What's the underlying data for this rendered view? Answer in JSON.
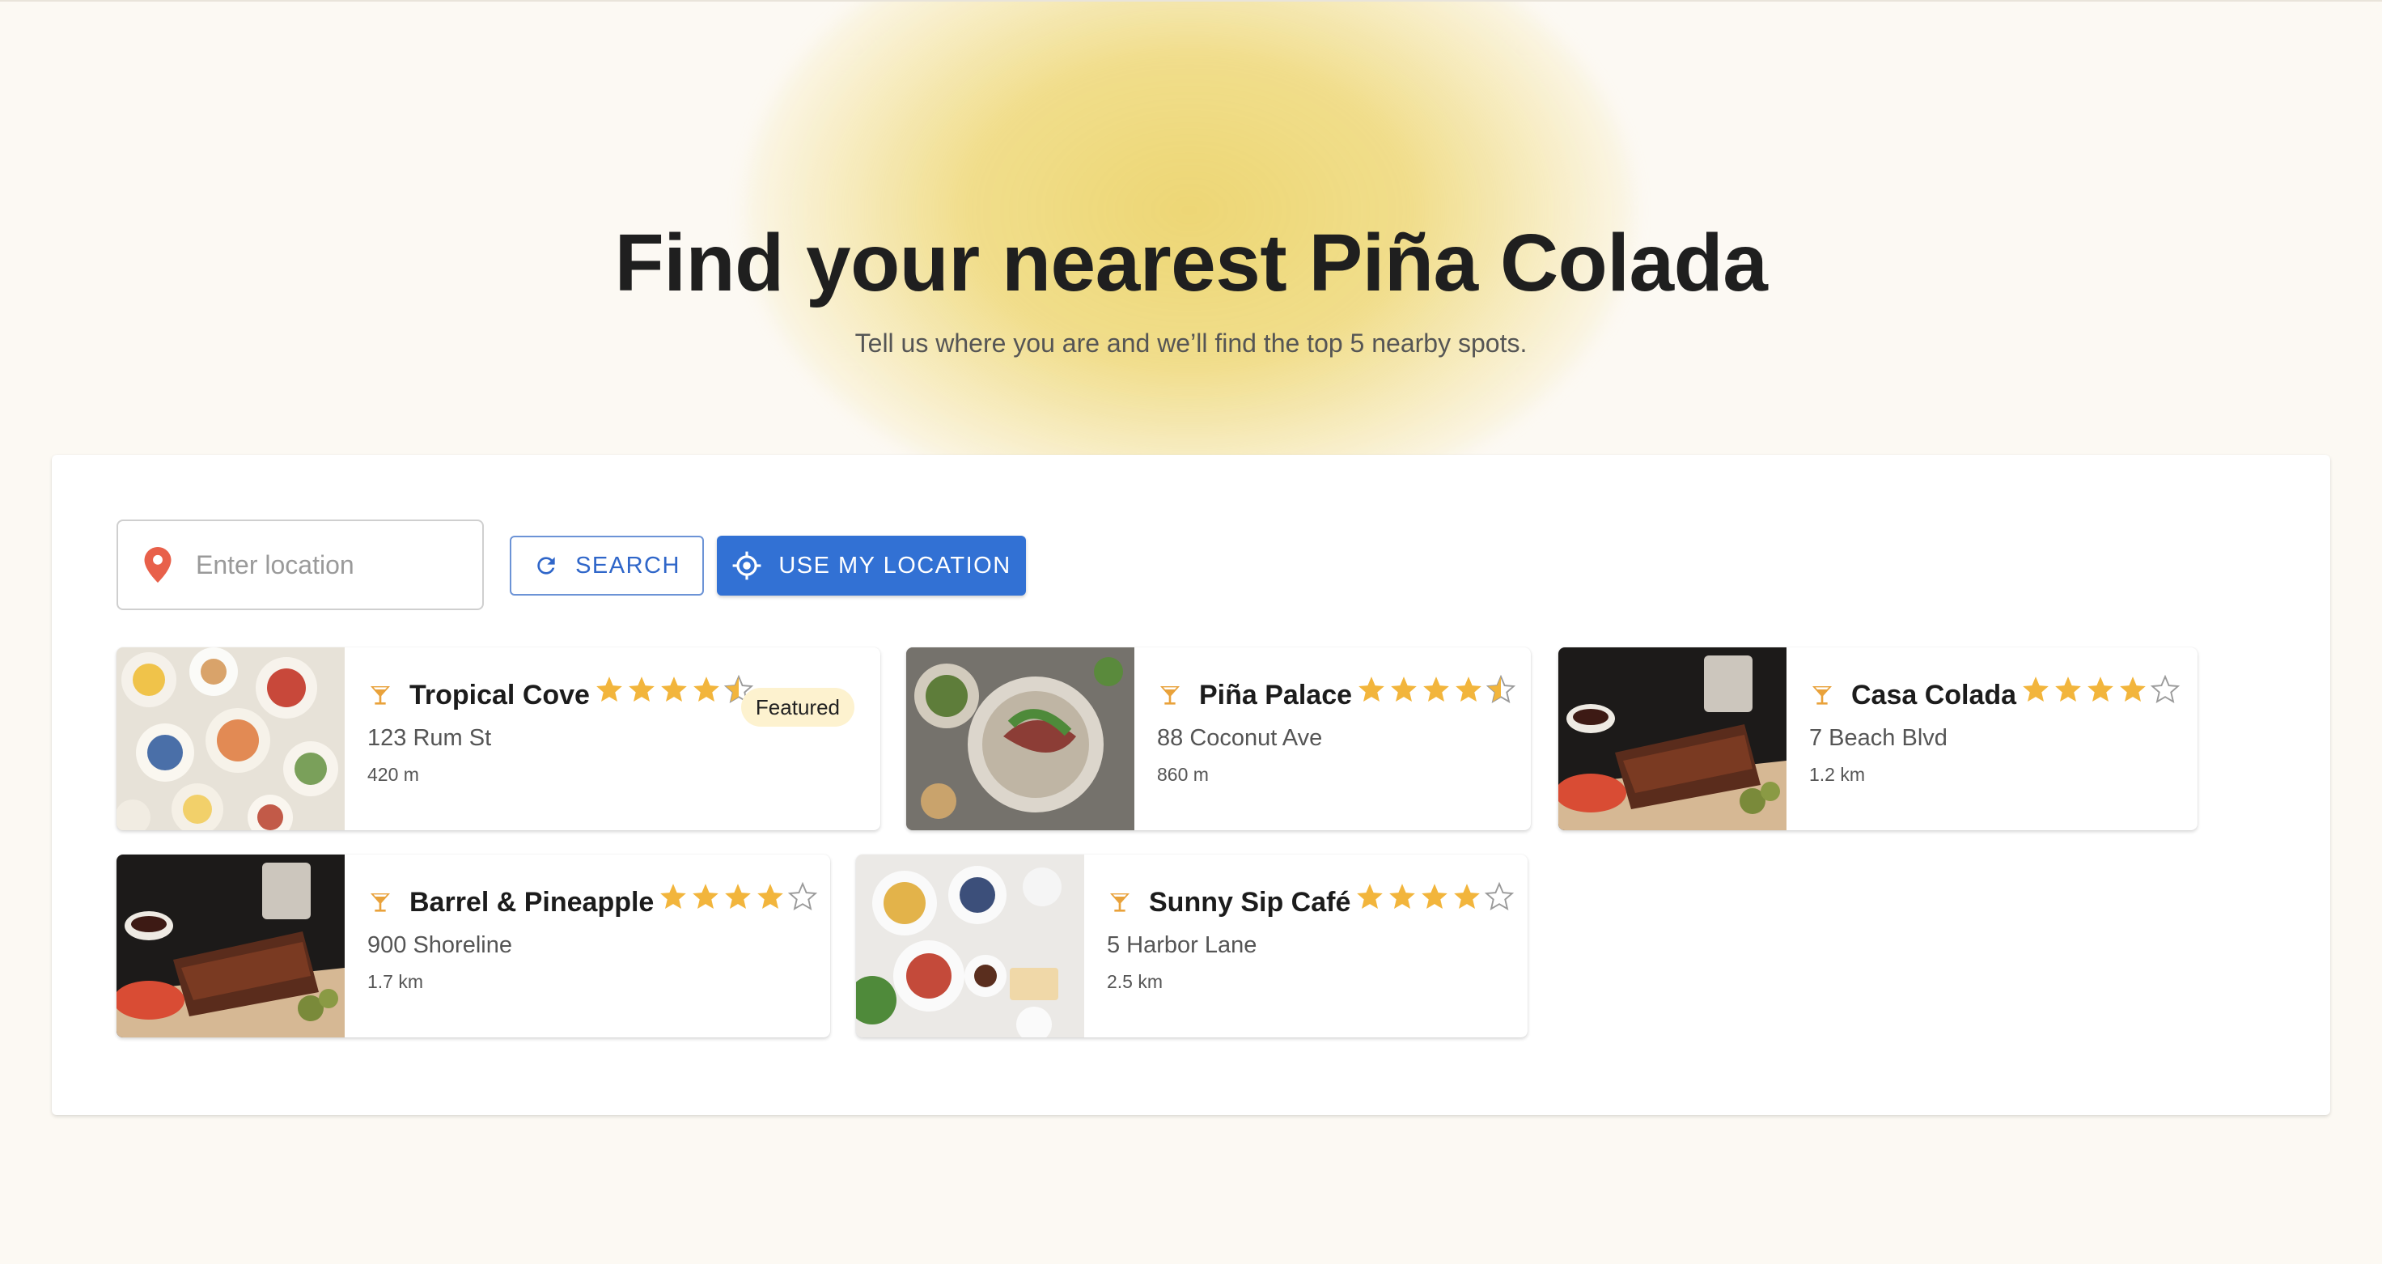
{
  "hero": {
    "title": "Find your nearest Piña Colada",
    "subtitle": "Tell us where you are and we’ll find the top 5 nearby spots."
  },
  "search": {
    "placeholder": "Enter location",
    "search_label": "SEARCH",
    "use_location_label": "USE MY LOCATION"
  },
  "colors": {
    "accent": "#3271d4",
    "star": "#f2b53c",
    "pin": "#e8604a",
    "badge_bg": "#fdf2cf"
  },
  "results": [
    {
      "name": "Tropical Cove",
      "address": "123 Rum St",
      "distance": "420 m",
      "rating": 4.5,
      "featured": true,
      "badge": "Featured",
      "image": "brunch-spread"
    },
    {
      "name": "Piña Palace",
      "address": "88 Coconut Ave",
      "distance": "860 m",
      "rating": 4.5,
      "featured": false,
      "image": "steak-salad"
    },
    {
      "name": "Casa Colada",
      "address": "7 Beach Blvd",
      "distance": "1.2 km",
      "rating": 4,
      "featured": false,
      "image": "ribs-fries"
    },
    {
      "name": "Barrel & Pineapple",
      "address": "900 Shoreline",
      "distance": "1.7 km",
      "rating": 4,
      "featured": false,
      "image": "ribs-fries"
    },
    {
      "name": "Sunny Sip Café",
      "address": "5 Harbor Lane",
      "distance": "2.5 km",
      "rating": 4,
      "featured": false,
      "image": "breakfast-bowls"
    }
  ]
}
